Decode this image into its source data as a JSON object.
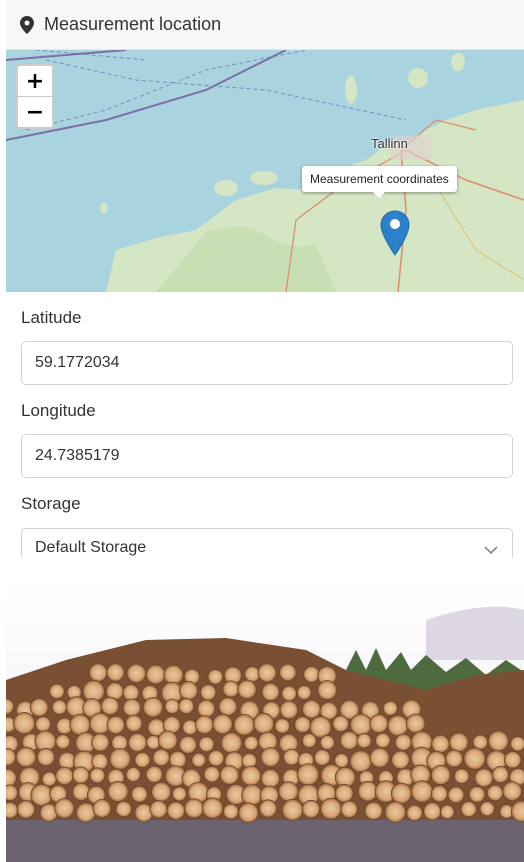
{
  "header": {
    "title": "Measurement location",
    "icon": "map-marker-icon"
  },
  "map": {
    "zoom_in_label": "+",
    "zoom_out_label": "−",
    "city_label": "Tallinn",
    "tooltip": "Measurement coordinates",
    "marker_icon": "map-pin-icon",
    "marker_color": "#2b82cb"
  },
  "form": {
    "latitude": {
      "label": "Latitude",
      "value": "59.1772034"
    },
    "longitude": {
      "label": "Longitude",
      "value": "24.7385179"
    },
    "storage": {
      "label": "Storage",
      "selected": "Default Storage"
    }
  },
  "photo": {
    "description_icon": "timber-log-pile-photo"
  },
  "colors": {
    "header_bg": "#f7f7f7",
    "sea": "#a9d3df",
    "land": "#d4e6c4",
    "input_border": "#ced4da"
  }
}
